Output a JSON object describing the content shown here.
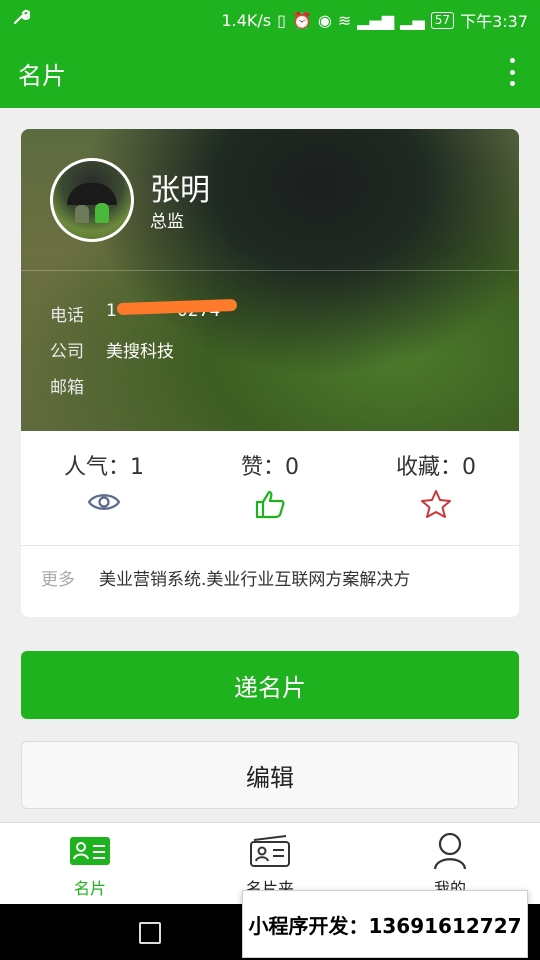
{
  "status_bar": {
    "speed": "1.4K/s",
    "battery": "57",
    "time": "下午3:37"
  },
  "app_bar": {
    "title": "名片"
  },
  "card": {
    "name": "张明",
    "role": "总监",
    "phone_label": "电话",
    "phone_value": "1••••••0274",
    "company_label": "公司",
    "company_value": "美搜科技",
    "email_label": "邮箱",
    "email_value": "",
    "stats": [
      {
        "text": "人气：1",
        "icon": "eye-icon"
      },
      {
        "text": "赞：0",
        "icon": "thumbs-up-icon"
      },
      {
        "text": "收藏：0",
        "icon": "star-icon"
      }
    ],
    "more_label": "更多",
    "more_value": "美业营销系统.美业行业互联网方案解决方"
  },
  "buttons": {
    "send": "递名片",
    "edit": "编辑"
  },
  "tabs": [
    {
      "label": "名片",
      "icon": "card-icon",
      "active": true
    },
    {
      "label": "名片夹",
      "icon": "cardholder-icon",
      "active": false
    },
    {
      "label": "我的",
      "icon": "user-icon",
      "active": false
    }
  ],
  "promo": "小程序开发：13691612727",
  "colors": {
    "brand": "#1fb21f",
    "eye": "#5a6a8a",
    "thumb": "#1fb21f",
    "star": "#c8363a"
  }
}
